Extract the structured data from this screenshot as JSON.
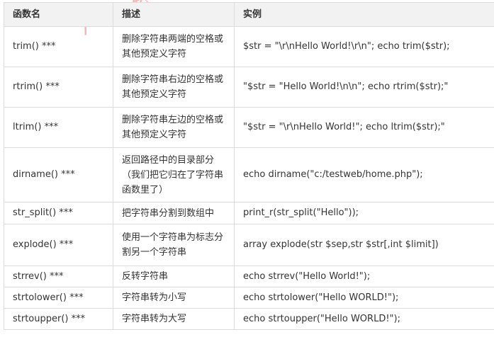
{
  "headers": [
    "函数名",
    "描述",
    "实例"
  ],
  "rows": [
    {
      "name": "trim() ***",
      "desc": "删除字符串两端的空格或其他预定义字符",
      "example": "$str = \"\\r\\nHello World!\\r\\n\"; echo trim($str);"
    },
    {
      "name": "rtrim() ***",
      "desc": "删除字符串右边的空格或其他预定义字符",
      "example": "\"$str = \"Hello World!\\n\\n\"; echo rtrim($str);\""
    },
    {
      "name": "ltrim() ***",
      "desc": "删除字符串左边的空格或其他预定义字符",
      "example": "\"$str = \"\\r\\nHello World!\"; echo ltrim($str);\""
    },
    {
      "name": "dirname() ***",
      "desc": "返回路径中的目录部分（我们把它归在了字符串函数里了）",
      "example": "echo dirname(\"c:/testweb/home.php\");"
    },
    {
      "name": "str_split() ***",
      "desc": "把字符串分割到数组中",
      "example": "print_r(str_split(\"Hello\"));"
    },
    {
      "name": "explode() ***",
      "desc": "使用一个字符串为标志分割另一个字符串",
      "example": "array explode(str $sep,str $str[,int $limit])"
    },
    {
      "name": "strrev() ***",
      "desc": "反转字符串",
      "example": "echo strrev(\"Hello World!\");"
    },
    {
      "name": "strtolower() ***",
      "desc": "字符串转为小写",
      "example": "echo strtolower(\"Hello WORLD!\");"
    },
    {
      "name": "strtoupper() ***",
      "desc": "字符串转为大写",
      "example": "echo strtoupper(\"Hello WORLD!\");"
    }
  ],
  "colors": {
    "header_bg": "#f2f2f2",
    "border": "#dcdcdc",
    "text": "#333333",
    "watermark": "#e15a5a"
  }
}
